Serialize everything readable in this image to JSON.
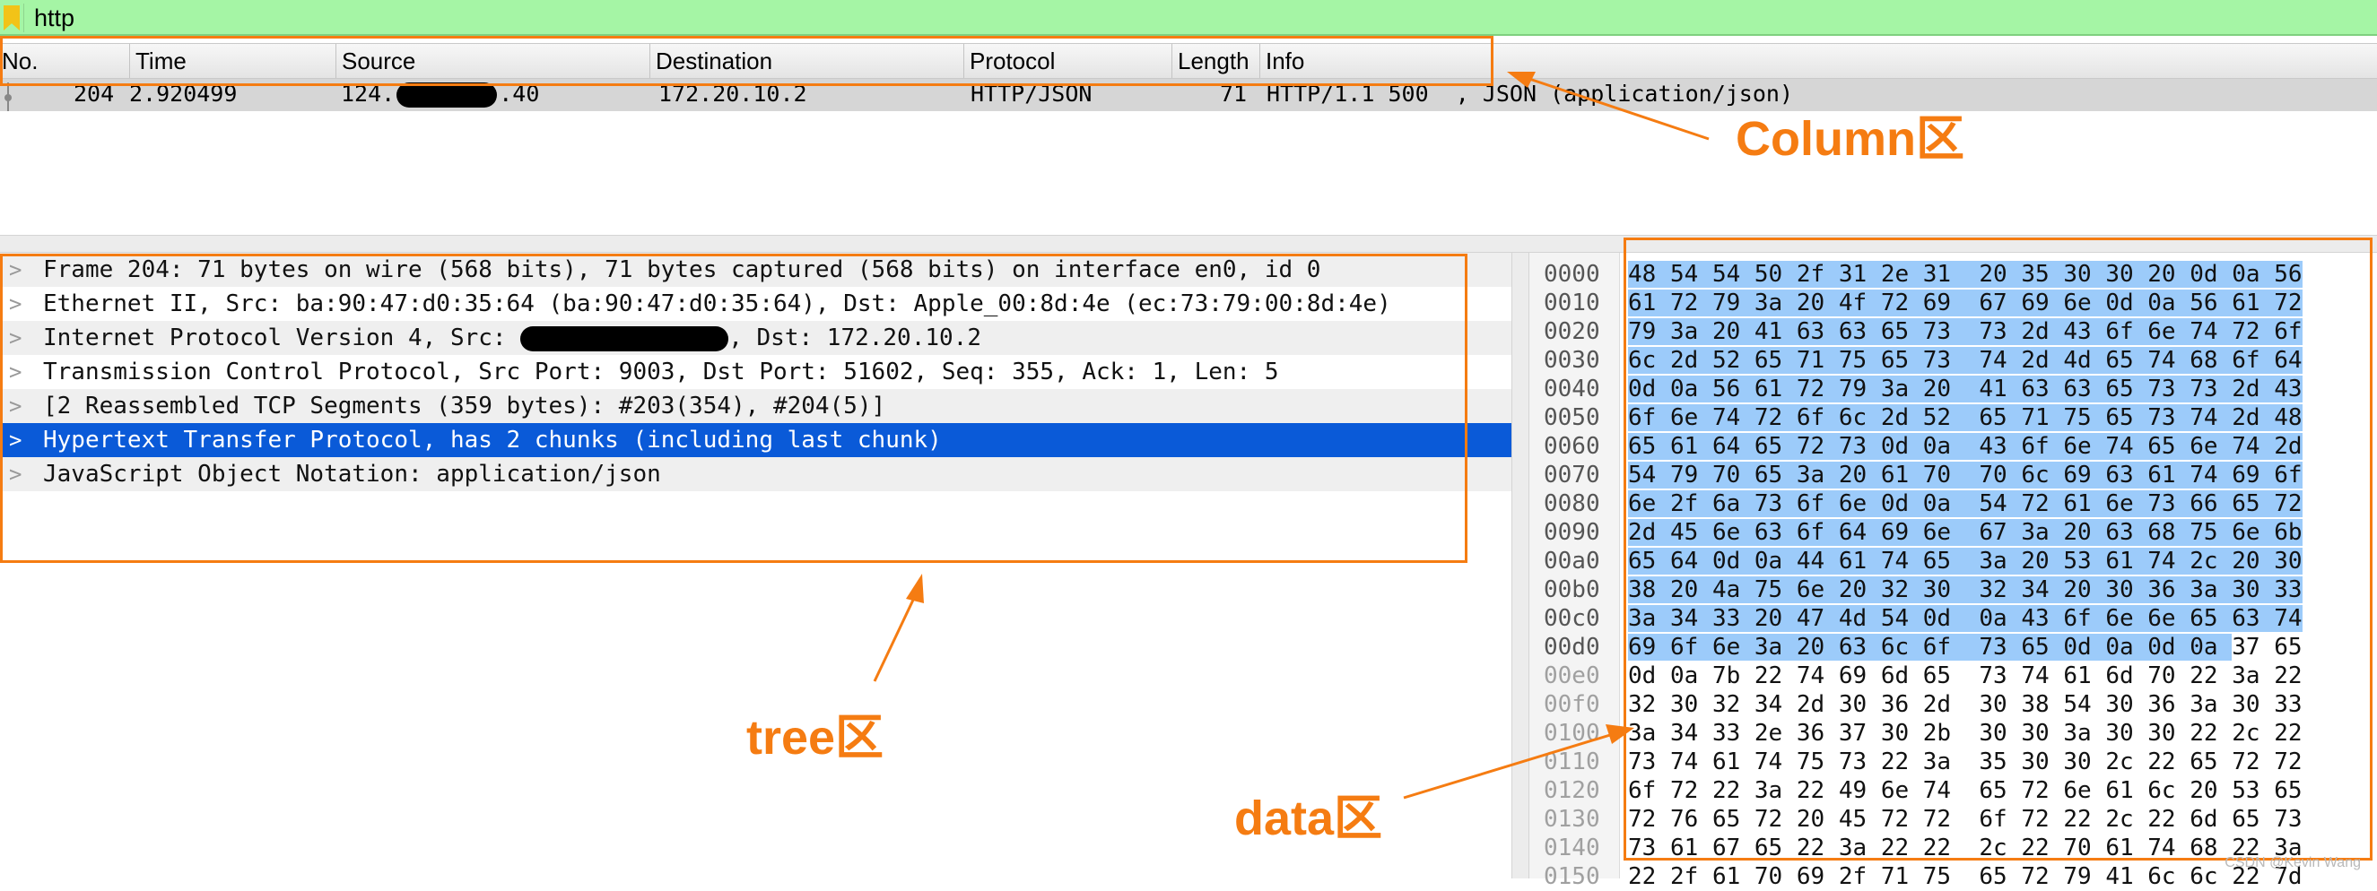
{
  "filter": {
    "text": "http",
    "icon": "bookmark-icon"
  },
  "columns": [
    "No.",
    "Time",
    "Source",
    "Destination",
    "Protocol",
    "Length",
    "Info"
  ],
  "packet": {
    "no": "204",
    "time": "2.920499",
    "source_prefix": "124.",
    "source_suffix": ".40",
    "destination": "172.20.10.2",
    "protocol": "HTTP/JSON",
    "length": "71",
    "info": "HTTP/1.1 500  , JSON (application/json)"
  },
  "tree": [
    {
      "label": "Frame 204: 71 bytes on wire (568 bits), 71 bytes captured (568 bits) on interface en0, id 0"
    },
    {
      "label": "Ethernet II, Src: ba:90:47:d0:35:64 (ba:90:47:d0:35:64), Dst: Apple_00:8d:4e (ec:73:79:00:8d:4e)"
    },
    {
      "label": "Internet Protocol Version 4, Src: ",
      "label_after": ", Dst: 172.20.10.2"
    },
    {
      "label": "Transmission Control Protocol, Src Port: 9003, Dst Port: 51602, Seq: 355, Ack: 1, Len: 5"
    },
    {
      "label": "[2 Reassembled TCP Segments (359 bytes): #203(354), #204(5)]"
    },
    {
      "label": "Hypertext Transfer Protocol, has 2 chunks (including last chunk)",
      "selected": true
    },
    {
      "label": "JavaScript Object Notation: application/json"
    }
  ],
  "bytes": [
    {
      "offset": "0000",
      "hex": "48 54 54 50 2f 31 2e 31  20 35 30 30 20 0d 0a 56",
      "hl": 16
    },
    {
      "offset": "0010",
      "hex": "61 72 79 3a 20 4f 72 69  67 69 6e 0d 0a 56 61 72",
      "hl": 16
    },
    {
      "offset": "0020",
      "hex": "79 3a 20 41 63 63 65 73  73 2d 43 6f 6e 74 72 6f",
      "hl": 16
    },
    {
      "offset": "0030",
      "hex": "6c 2d 52 65 71 75 65 73  74 2d 4d 65 74 68 6f 64",
      "hl": 16
    },
    {
      "offset": "0040",
      "hex": "0d 0a 56 61 72 79 3a 20  41 63 63 65 73 73 2d 43",
      "hl": 16
    },
    {
      "offset": "0050",
      "hex": "6f 6e 74 72 6f 6c 2d 52  65 71 75 65 73 74 2d 48",
      "hl": 16
    },
    {
      "offset": "0060",
      "hex": "65 61 64 65 72 73 0d 0a  43 6f 6e 74 65 6e 74 2d",
      "hl": 16
    },
    {
      "offset": "0070",
      "hex": "54 79 70 65 3a 20 61 70  70 6c 69 63 61 74 69 6f",
      "hl": 16
    },
    {
      "offset": "0080",
      "hex": "6e 2f 6a 73 6f 6e 0d 0a  54 72 61 6e 73 66 65 72",
      "hl": 16
    },
    {
      "offset": "0090",
      "hex": "2d 45 6e 63 6f 64 69 6e  67 3a 20 63 68 75 6e 6b",
      "hl": 16
    },
    {
      "offset": "00a0",
      "hex": "65 64 0d 0a 44 61 74 65  3a 20 53 61 74 2c 20 30",
      "hl": 16
    },
    {
      "offset": "00b0",
      "hex": "38 20 4a 75 6e 20 32 30  32 34 20 30 36 3a 30 33",
      "hl": 16
    },
    {
      "offset": "00c0",
      "hex": "3a 34 33 20 47 4d 54 0d  0a 43 6f 6e 6e 65 63 74",
      "hl": 16
    },
    {
      "offset": "00d0",
      "hex": "69 6f 6e 3a 20 63 6c 6f  73 65 0d 0a 0d 0a 37 65",
      "hl": 14
    },
    {
      "offset": "00e0",
      "hex": "0d 0a 7b 22 74 69 6d 65  73 74 61 6d 70 22 3a 22",
      "hl": 0
    },
    {
      "offset": "00f0",
      "hex": "32 30 32 34 2d 30 36 2d  30 38 54 30 36 3a 30 33",
      "hl": 0
    },
    {
      "offset": "0100",
      "hex": "3a 34 33 2e 36 37 30 2b  30 30 3a 30 30 22 2c 22",
      "hl": 0
    },
    {
      "offset": "0110",
      "hex": "73 74 61 74 75 73 22 3a  35 30 30 2c 22 65 72 72",
      "hl": 0
    },
    {
      "offset": "0120",
      "hex": "6f 72 22 3a 22 49 6e 74  65 72 6e 61 6c 20 53 65",
      "hl": 0
    },
    {
      "offset": "0130",
      "hex": "72 76 65 72 20 45 72 72  6f 72 22 2c 22 6d 65 73",
      "hl": 0
    },
    {
      "offset": "0140",
      "hex": "73 61 67 65 22 3a 22 22  2c 22 70 61 74 68 22 3a",
      "hl": 0
    },
    {
      "offset": "0150",
      "hex": "22 2f 61 70 69 2f 71 75  65 72 79 41 6c 6c 22 7d",
      "hl": 0
    }
  ],
  "annotations": {
    "column": "Column区",
    "tree": "tree区",
    "data": "data区",
    "color": "#f57c12"
  },
  "watermark": "CSDN @Kevin Wang"
}
